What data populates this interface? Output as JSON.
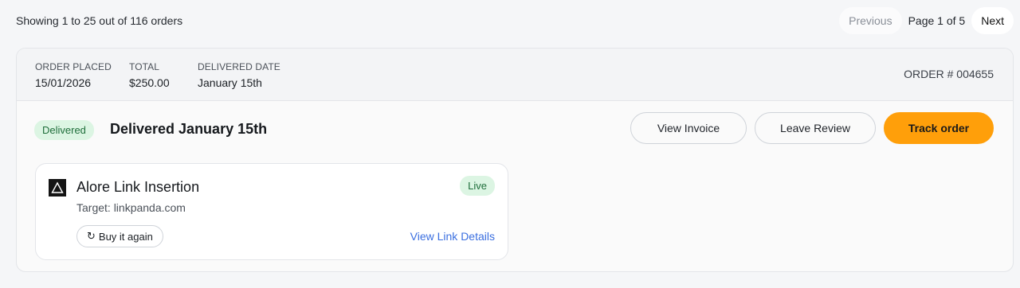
{
  "listing": {
    "showing_text": "Showing 1 to 25 out of 116 orders",
    "pagination": {
      "previous_label": "Previous",
      "page_label": "Page 1 of 5",
      "next_label": "Next"
    }
  },
  "order": {
    "placed_label": "ORDER PLACED",
    "placed_value": "15/01/2026",
    "total_label": "TOTAL",
    "total_value": "$250.00",
    "delivered_label": "DELIVERED DATE",
    "delivered_value": "January 15th",
    "order_number": "ORDER # 004655",
    "status_badge": "Delivered",
    "status_title": "Delivered January 15th",
    "actions": {
      "view_invoice": "View Invoice",
      "leave_review": "Leave Review",
      "track_order": "Track order"
    },
    "item": {
      "icon": "alore-triangle-logo",
      "title": "Alore Link Insertion",
      "target": "Target: linkpanda.com",
      "live_badge": "Live",
      "buy_again": "Buy it again",
      "view_details": "View Link Details"
    }
  },
  "colors": {
    "accent": "#ff9f0a",
    "success_bg": "#dcf5e3",
    "success_text": "#1f6e3b",
    "link": "#3b6fe0"
  }
}
